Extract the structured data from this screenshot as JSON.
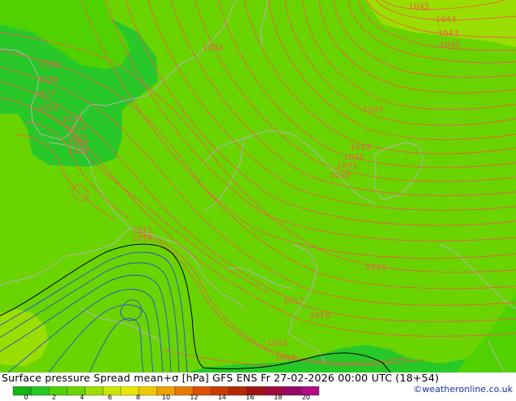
{
  "title": "Surface pressure Spread mean+σ [hPa] GFS ENS   Fr 27-02-2026 00:00 UTC (18+54)",
  "credit": "©weatheronline.co.uk",
  "colors": {
    "field_green": "#6ad400",
    "dark_green": "#28c828",
    "light_green": "#9ade00",
    "isobar_high": "#e8604a",
    "isobar_low": "#2a4fd0",
    "border_gray": "#b4b4b4"
  },
  "colorbar": {
    "ticks": [
      "0",
      "2",
      "4",
      "6",
      "8",
      "10",
      "12",
      "14",
      "16",
      "18",
      "20"
    ],
    "colors": [
      "#14b414",
      "#28c828",
      "#50d200",
      "#6ad400",
      "#9ade00",
      "#c8e600",
      "#e6e600",
      "#f0c800",
      "#f0a000",
      "#e67800",
      "#dc5000",
      "#c83c00",
      "#b42800",
      "#a01414",
      "#a00a3c",
      "#960a64",
      "#b40a82"
    ]
  },
  "isobar_labels": [
    {
      "text": "1045",
      "name": "label-1045"
    },
    {
      "text": "1044",
      "name": "label-1044"
    },
    {
      "text": "1043",
      "name": "label-1043"
    },
    {
      "text": "1042",
      "name": "label-1042"
    },
    {
      "text": "1034",
      "name": "label-1034"
    },
    {
      "text": "1029",
      "name": "label-1029"
    },
    {
      "text": "1028",
      "name": "label-1028"
    },
    {
      "text": "1027",
      "name": "label-1027"
    },
    {
      "text": "1026",
      "name": "label-1026"
    },
    {
      "text": "1025",
      "name": "label-1025"
    },
    {
      "text": "1024",
      "name": "label-1024"
    },
    {
      "text": "1023",
      "name": "label-1023-west"
    },
    {
      "text": "1022",
      "name": "label-1022"
    },
    {
      "text": "1020",
      "name": "label-1020"
    },
    {
      "text": "1037",
      "name": "label-1037"
    },
    {
      "text": "1033",
      "name": "label-1033"
    },
    {
      "text": "1032",
      "name": "label-1032"
    },
    {
      "text": "1031",
      "name": "label-1031"
    },
    {
      "text": "1030",
      "name": "label-1030"
    },
    {
      "text": "1015",
      "name": "label-1015-north"
    },
    {
      "text": "1014",
      "name": "label-1014-north"
    },
    {
      "text": "1023",
      "name": "label-1023-east"
    },
    {
      "text": "1017",
      "name": "label-1017"
    },
    {
      "text": "1016",
      "name": "label-1016"
    },
    {
      "text": "1015",
      "name": "label-1015-south"
    },
    {
      "text": "1014",
      "name": "label-1014-south"
    }
  ]
}
